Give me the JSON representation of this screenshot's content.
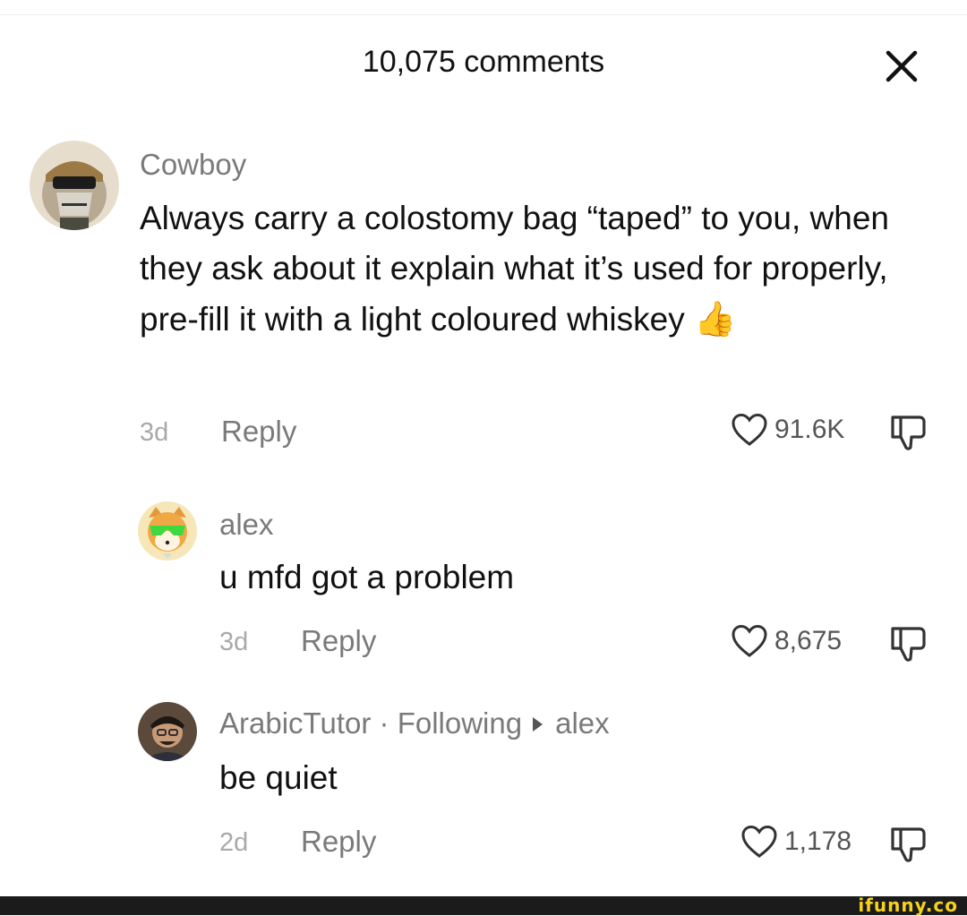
{
  "header": {
    "title": "10,075 comments"
  },
  "comments": [
    {
      "username": "Cowboy",
      "text": "Always carry a colostomy bag “taped” to you, when they ask about it explain what it’s used for properly, pre-fill it with a light coloured whiskey",
      "emoji": "👍",
      "age": "3d",
      "reply_label": "Reply",
      "likes": "91.6K"
    },
    {
      "username": "alex",
      "text": "u mfd got a problem",
      "age": "3d",
      "reply_label": "Reply",
      "likes": "8,675"
    },
    {
      "username": "ArabicTutor",
      "separator": "·",
      "following_label": "Following",
      "reply_to": "alex",
      "text": "be quiet",
      "age": "2d",
      "reply_label": "Reply",
      "likes": "1,178"
    }
  ],
  "watermark": "ifunny.co",
  "icons": {
    "close": "close-icon",
    "like": "heart-outline-icon",
    "dislike": "thumbs-down-icon"
  },
  "colors": {
    "text": "#111111",
    "muted": "#7a7a7a",
    "age": "#a9a9a9",
    "watermark": "#f6d21a"
  }
}
